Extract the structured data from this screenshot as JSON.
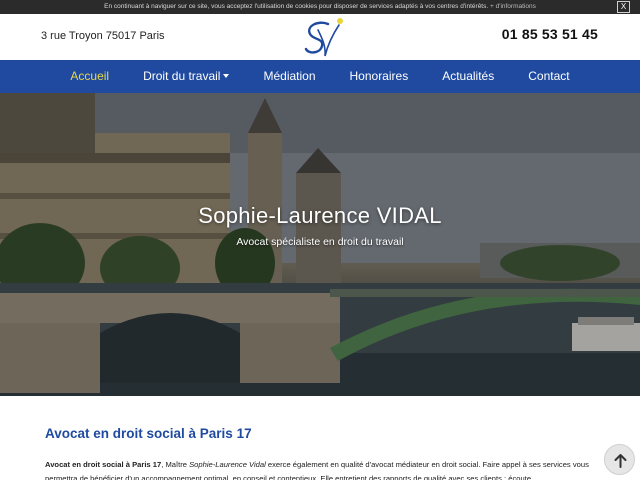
{
  "cookie_bar": {
    "text": "En continuant à naviguer sur ce site, vous acceptez l'utilisation de cookies pour disposer de services adaptés à vos centres d'intérêts.",
    "more_link": "+ d'informations",
    "close_label": "X"
  },
  "header": {
    "address": "3 rue Troyon 75017 Paris",
    "logo_icon": "sv-monogram-logo",
    "phone": "01 85 53 51 45"
  },
  "nav": {
    "items": [
      {
        "label": "Accueil",
        "active": true
      },
      {
        "label": "Droit du travail",
        "dropdown": true
      },
      {
        "label": "Médiation"
      },
      {
        "label": "Honoraires"
      },
      {
        "label": "Actualités"
      },
      {
        "label": "Contact"
      }
    ]
  },
  "hero": {
    "title": "Sophie-Laurence VIDAL",
    "subtitle": "Avocat spécialiste en droit du travail"
  },
  "main": {
    "section_title": "Avocat en droit social à Paris 17",
    "para_bold": "Avocat en droit social à Paris 17",
    "para_part1": ", Maître ",
    "para_italic": "Sophie-Laurence Vidal",
    "para_part2": " exerce également en qualité d'avocat médiateur en droit social. Faire appel à ses services vous permettra de bénéficier d'un accompagnement optimal, en conseil et contentieux. Elle entretient des rapports de qualité avec ses clients : écoute,"
  },
  "scroll_top": {
    "icon": "arrow-up-icon"
  },
  "colors": {
    "nav_bg": "#1f4aa0",
    "nav_active": "#e9d84a",
    "title_blue": "#1f4aa0",
    "cookie_bg": "#2b2b2b"
  }
}
